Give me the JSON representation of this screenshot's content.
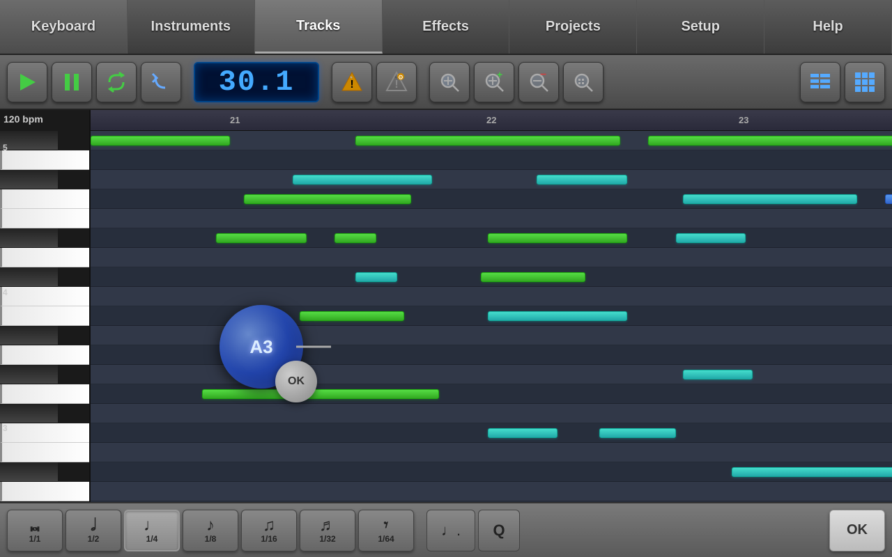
{
  "nav": {
    "tabs": [
      {
        "id": "keyboard",
        "label": "Keyboard",
        "active": false
      },
      {
        "id": "instruments",
        "label": "Instruments",
        "active": false
      },
      {
        "id": "tracks",
        "label": "Tracks",
        "active": true
      },
      {
        "id": "effects",
        "label": "Effects",
        "active": false
      },
      {
        "id": "projects",
        "label": "Projects",
        "active": false
      },
      {
        "id": "setup",
        "label": "Setup",
        "active": false
      },
      {
        "id": "help",
        "label": "Help",
        "active": false
      }
    ]
  },
  "toolbar": {
    "tempo": "30.1",
    "play_label": "Play",
    "pause_label": "Pause",
    "loop_label": "Loop",
    "undo_label": "Undo"
  },
  "track_area": {
    "bpm": "120 bpm",
    "ruler_marks": [
      "21",
      "22",
      "23"
    ],
    "pitch_bubble": {
      "note": "A3",
      "ok_label": "OK"
    }
  },
  "bottom_bar": {
    "note_buttons": [
      {
        "symbol": "𝅜",
        "fraction": "1/1",
        "id": "note-1-1"
      },
      {
        "symbol": "𝅗𝅥",
        "fraction": "1/2",
        "id": "note-1-2"
      },
      {
        "symbol": "♩",
        "fraction": "1/4",
        "id": "note-1-4",
        "active": true
      },
      {
        "symbol": "♪",
        "fraction": "1/8",
        "id": "note-1-8"
      },
      {
        "symbol": "♫",
        "fraction": "1/16",
        "id": "note-1-16"
      },
      {
        "symbol": "♬",
        "fraction": "1/32",
        "id": "note-1-32"
      },
      {
        "symbol": "𝄾",
        "fraction": "1/64",
        "id": "note-1-64"
      }
    ],
    "dotted_label": ".",
    "quantize_label": "Q",
    "ok_label": "OK"
  }
}
